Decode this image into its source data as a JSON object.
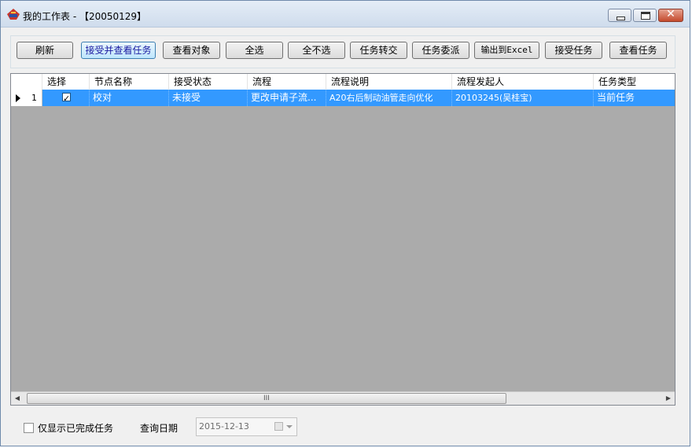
{
  "window": {
    "title": "我的工作表 - 【20050129】"
  },
  "toolbar": {
    "buttons": [
      {
        "label": "刷新"
      },
      {
        "label": "接受并查看任务"
      },
      {
        "label": "查看对象"
      },
      {
        "label": "全选"
      },
      {
        "label": "全不选"
      },
      {
        "label": "任务转交"
      },
      {
        "label": "任务委派"
      },
      {
        "label": "输出到Excel"
      },
      {
        "label": "接受任务"
      },
      {
        "label": "查看任务"
      }
    ]
  },
  "grid": {
    "columns": [
      "选择",
      "节点名称",
      "接受状态",
      "流程",
      "流程说明",
      "流程发起人",
      "任务类型"
    ],
    "rows": [
      {
        "row_number": "1",
        "selected": true,
        "node_name": "校对",
        "accept_status": "未接受",
        "process": "更改申请子流...",
        "process_desc": "A20右后制动油管走向优化",
        "initiator": "20103245(吴桂宝)",
        "task_type": "当前任务"
      }
    ],
    "scroll_grip": "III"
  },
  "footer": {
    "only_completed_label": "仅显示已完成任务",
    "query_date_label": "查询日期",
    "query_date_value": "2015-12-13"
  },
  "colors": {
    "selection": "#3399ff",
    "grid_bg": "#ababab"
  },
  "icons": [
    "app-icon",
    "minimize-icon",
    "maximize-icon",
    "close-icon",
    "row-indicator-icon",
    "calendar-icon",
    "dropdown-arrow-icon"
  ]
}
